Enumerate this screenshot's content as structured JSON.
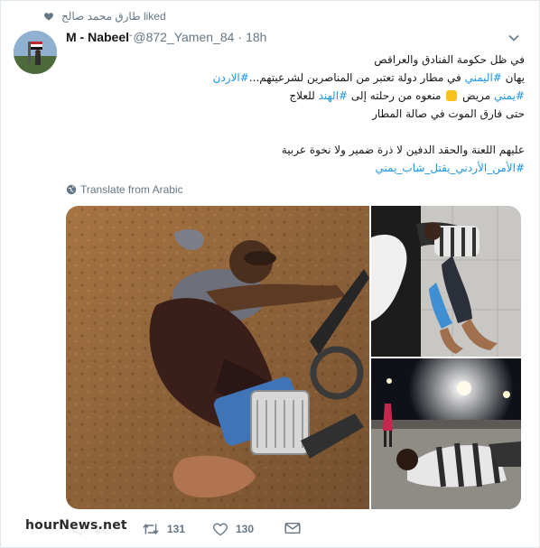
{
  "social_context": {
    "icon": "heart-icon",
    "text": "طارق محمد صالح liked"
  },
  "tweet": {
    "author_name": "M - Nabeel",
    "author_handle": "@872_Yamen_84",
    "separator": "·",
    "time": "18h",
    "lines": [
      [
        {
          "t": "في ظل حكومة الفنادق والعراقص"
        }
      ],
      [
        {
          "t": "يهان "
        },
        {
          "t": "#اليمني",
          "tag": true
        },
        {
          "t": " في مطار دولة تعتبر من المناصرين لشرعيتهم..."
        },
        {
          "t": "#الاردن",
          "tag": true
        }
      ],
      [
        {
          "t": "#يمني",
          "tag": true
        },
        {
          "t": " مريض "
        },
        {
          "emoji": true
        },
        {
          "t": " منعوه من رحلته إلى "
        },
        {
          "t": "#الهند",
          "tag": true
        },
        {
          "t": " للعلاج"
        }
      ],
      [
        {
          "t": "حتى فارق الموت في صالة المطار"
        }
      ],
      [],
      [
        {
          "t": "عليهم اللعنة والحقد الدفين لا ذرة ضمير ولا نخوة عربية"
        }
      ],
      [
        {
          "t": "#الأمن_الأردني_يقتل_شاب_يمني",
          "tag": true
        }
      ]
    ],
    "translate_label": "Translate from Arabic",
    "media": [
      {
        "name": "photo-man-on-airport-floor"
      },
      {
        "name": "photo-man-lying-on-tiles"
      },
      {
        "name": "photo-man-outside-at-night"
      }
    ]
  },
  "actions": {
    "reply": {
      "icon": "reply-icon",
      "count": "22"
    },
    "retweet": {
      "icon": "retweet-icon",
      "count": "131"
    },
    "like": {
      "icon": "heart-outline-icon",
      "count": "130"
    },
    "dm": {
      "icon": "envelope-icon"
    }
  },
  "watermark": {
    "text": "hourNews.net"
  },
  "colors": {
    "link": "#1b95e0",
    "muted": "#657786",
    "text": "#14171a"
  }
}
